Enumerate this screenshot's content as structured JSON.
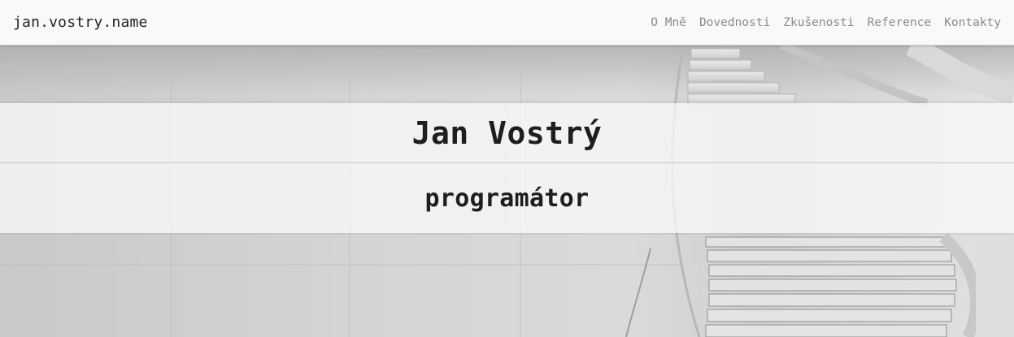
{
  "navbar": {
    "brand": "jan.vostry.name",
    "links": [
      {
        "label": "O Mně"
      },
      {
        "label": "Dovednosti"
      },
      {
        "label": "Zkušenosti"
      },
      {
        "label": "Reference"
      },
      {
        "label": "Kontakty"
      }
    ]
  },
  "hero": {
    "name": "Jan Vostrý",
    "role": "programátor",
    "background": "staircase-photo"
  }
}
